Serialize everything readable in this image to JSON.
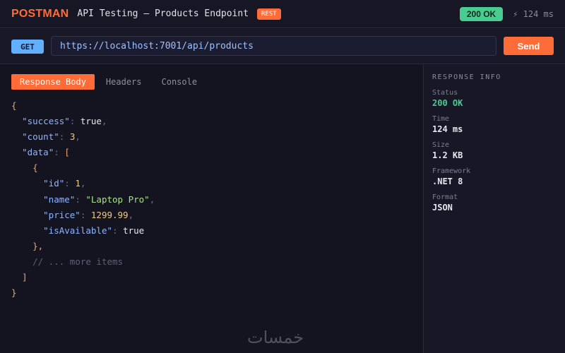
{
  "header": {
    "brand": "POSTMAN",
    "title": "API Testing — Products Endpoint",
    "badge": "REST",
    "status": "200 OK",
    "latency": "⚡ 124 ms"
  },
  "request": {
    "method": "GET",
    "url": "https://localhost:7001/api/products",
    "send_label": "Send"
  },
  "tabs": [
    "Response Body",
    "Headers",
    "Console"
  ],
  "body_lines": [
    {
      "tokens": [
        [
          "p",
          "{"
        ]
      ]
    },
    {
      "tokens": [
        [
          "b",
          "  "
        ],
        [
          "k",
          "\"success\""
        ],
        [
          "c",
          ": "
        ],
        [
          "b",
          "true"
        ],
        [
          "c",
          ","
        ]
      ]
    },
    {
      "tokens": [
        [
          "b",
          "  "
        ],
        [
          "k",
          "\"count\""
        ],
        [
          "c",
          ": "
        ],
        [
          "n",
          "3"
        ],
        [
          "c",
          ","
        ]
      ]
    },
    {
      "tokens": [
        [
          "b",
          "  "
        ],
        [
          "k",
          "\"data\""
        ],
        [
          "c",
          ": "
        ],
        [
          "p",
          "["
        ]
      ]
    },
    {
      "tokens": [
        [
          "b",
          "    "
        ],
        [
          "p",
          "{"
        ]
      ]
    },
    {
      "tokens": [
        [
          "b",
          "      "
        ],
        [
          "k",
          "\"id\""
        ],
        [
          "c",
          ": "
        ],
        [
          "n",
          "1"
        ],
        [
          "c",
          ","
        ]
      ]
    },
    {
      "tokens": [
        [
          "b",
          "      "
        ],
        [
          "k",
          "\"name\""
        ],
        [
          "c",
          ": "
        ],
        [
          "s",
          "\"Laptop Pro\""
        ],
        [
          "c",
          ","
        ]
      ]
    },
    {
      "tokens": [
        [
          "b",
          "      "
        ],
        [
          "k",
          "\"price\""
        ],
        [
          "c",
          ": "
        ],
        [
          "n",
          "1299.99"
        ],
        [
          "c",
          ","
        ]
      ]
    },
    {
      "tokens": [
        [
          "b",
          "      "
        ],
        [
          "k",
          "\"isAvailable\""
        ],
        [
          "c",
          ": "
        ],
        [
          "b",
          "true"
        ]
      ]
    },
    {
      "tokens": [
        [
          "b",
          "    "
        ],
        [
          "p",
          "},"
        ]
      ]
    },
    {
      "tokens": [
        [
          "b",
          "    "
        ],
        [
          "cm",
          "// ... more items"
        ]
      ]
    },
    {
      "tokens": [
        [
          "b",
          "  "
        ],
        [
          "p",
          "]"
        ]
      ]
    },
    {
      "tokens": [
        [
          "p",
          "}"
        ]
      ]
    }
  ],
  "sidebar": {
    "heading": "RESPONSE INFO",
    "items": [
      {
        "label": "Status",
        "value": "200 OK"
      },
      {
        "label": "Time",
        "value": "124 ms"
      },
      {
        "label": "Size",
        "value": "1.2 KB"
      },
      {
        "label": "Framework",
        "value": ".NET 8"
      },
      {
        "label": "Format",
        "value": "JSON"
      }
    ]
  },
  "watermark": "خمسات",
  "colors": {
    "accent": "#ff6c37",
    "success": "#49cc90",
    "method_get": "#61affe",
    "background": "#141421"
  }
}
